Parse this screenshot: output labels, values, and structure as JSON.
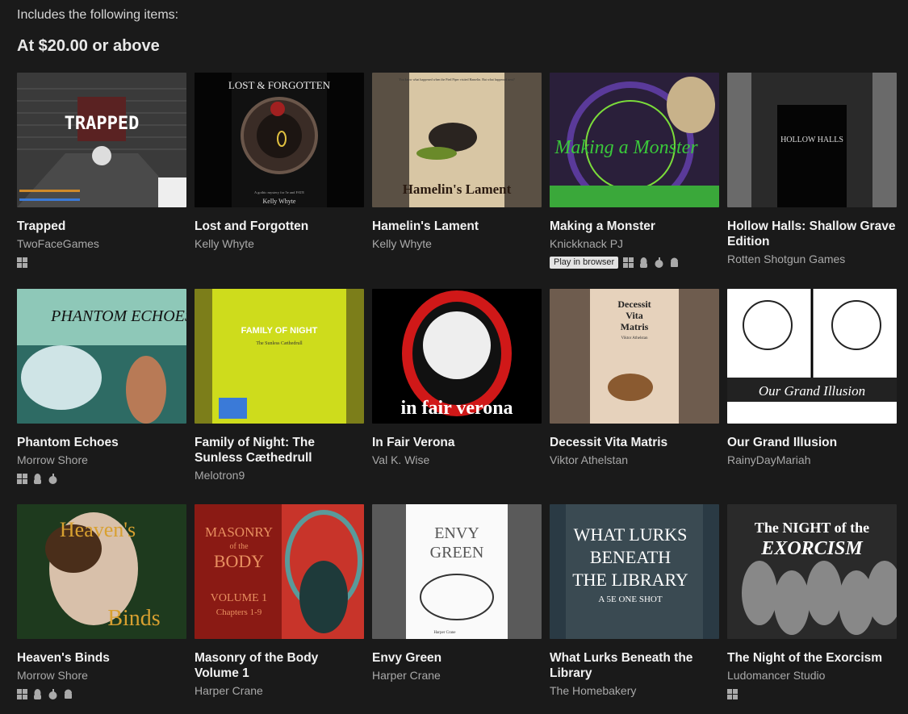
{
  "header": {
    "intro": "Includes the following items:",
    "tier": "At $20.00 or above"
  },
  "play_label": "Play in browser",
  "items": [
    {
      "title": "Trapped",
      "author": "TwoFaceGames",
      "cover_text": "TRAPPED",
      "platforms": [
        "windows"
      ]
    },
    {
      "title": "Lost and Forgotten",
      "author": "Kelly Whyte",
      "cover_text": "LOST & FORGOTTEN",
      "cover_sub": "Kelly Whyte",
      "cover_small": "A gothic mystery for 5e and FATE",
      "platforms": []
    },
    {
      "title": "Hamelin's Lament",
      "author": "Kelly Whyte",
      "cover_text": "Hamelin's Lament",
      "cover_small": "You know what happened when the Pied Piper visited Hamelin. But what happened next?",
      "platforms": []
    },
    {
      "title": "Making a Monster",
      "author": "Knickknack PJ",
      "cover_text": "Making a Monster",
      "browser": true,
      "platforms": [
        "windows",
        "linux",
        "mac",
        "android"
      ]
    },
    {
      "title": "Hollow Halls: Shallow Grave Edition",
      "author": "Rotten Shotgun Games",
      "cover_text": "HOLLOW HALLS",
      "platforms": []
    },
    {
      "title": "Phantom Echoes",
      "author": "Morrow Shore",
      "cover_text": "PHANTOM ECHOES",
      "platforms": [
        "windows",
        "linux",
        "mac"
      ]
    },
    {
      "title": "Family of Night: The Sunless Cæthedrull",
      "author": "Melotron9",
      "cover_text": "FAMILY OF NIGHT",
      "cover_sub": "The Sunless Cæthedrull",
      "platforms": []
    },
    {
      "title": "In Fair Verona",
      "author": "Val K. Wise",
      "cover_text": "in fair verona",
      "platforms": []
    },
    {
      "title": "Decessit Vita Matris",
      "author": "Viktor Athelstan",
      "cover_text": "Decessit Vita Matris",
      "cover_sub": "Viktor Athelstan",
      "platforms": []
    },
    {
      "title": "Our Grand Illusion",
      "author": "RainyDayMariah",
      "cover_text": "Our Grand Illusion",
      "platforms": []
    },
    {
      "title": "Heaven's Binds",
      "author": "Morrow Shore",
      "cover_text": "Heaven's",
      "cover_sub": "Binds",
      "platforms": [
        "windows",
        "linux",
        "mac",
        "android"
      ]
    },
    {
      "title": "Masonry of the Body Volume 1",
      "author": "Harper Crane",
      "cover_text": "MASONRY of the BODY",
      "cover_sub": "VOLUME 1",
      "cover_small": "Chapters 1-9",
      "platforms": []
    },
    {
      "title": "Envy Green",
      "author": "Harper Crane",
      "cover_text": "ENVY GREEN",
      "cover_sub": "Harper Crane",
      "platforms": []
    },
    {
      "title": "What Lurks Beneath the Library",
      "author": "The Homebakery",
      "cover_text": "WHAT LURKS BENEATH THE LIBRARY",
      "cover_sub": "A 5E ONE SHOT",
      "platforms": []
    },
    {
      "title": "The Night of the Exorcism",
      "author": "Ludomancer Studio",
      "cover_text": "The NIGHT of the",
      "cover_sub": "EXORCISM",
      "platforms": [
        "windows"
      ]
    }
  ]
}
